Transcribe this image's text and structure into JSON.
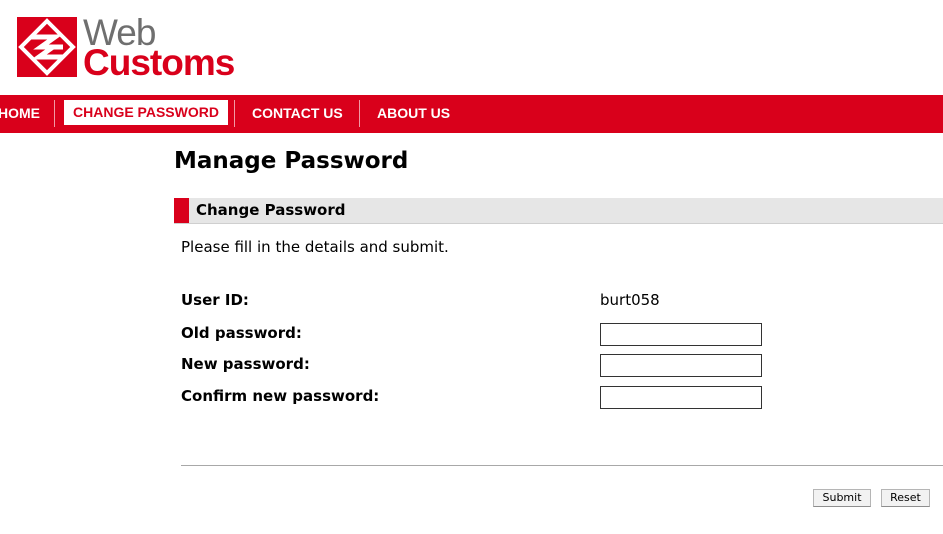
{
  "brand": {
    "logo_icon": "webcustoms-logo-icon",
    "name_line1": "Web",
    "name_line2": "Customs",
    "accent_color": "#d9001b",
    "grey_color": "#6f6f6f"
  },
  "nav": {
    "items": [
      {
        "label": "HOME",
        "active": false
      },
      {
        "label": "CHANGE PASSWORD",
        "active": true
      },
      {
        "label": "CONTACT US",
        "active": false
      },
      {
        "label": "ABOUT US",
        "active": false
      }
    ]
  },
  "page": {
    "title": "Manage Password",
    "section_title": "Change Password",
    "intro": "Please fill in the details and submit."
  },
  "form": {
    "user_id_label": "User ID:",
    "user_id_value": "burt058",
    "old_password_label": "Old password:",
    "old_password_value": "",
    "new_password_label": "New password:",
    "new_password_value": "",
    "confirm_password_label": "Confirm new password:",
    "confirm_password_value": ""
  },
  "actions": {
    "submit_label": "Submit",
    "reset_label": "Reset"
  }
}
